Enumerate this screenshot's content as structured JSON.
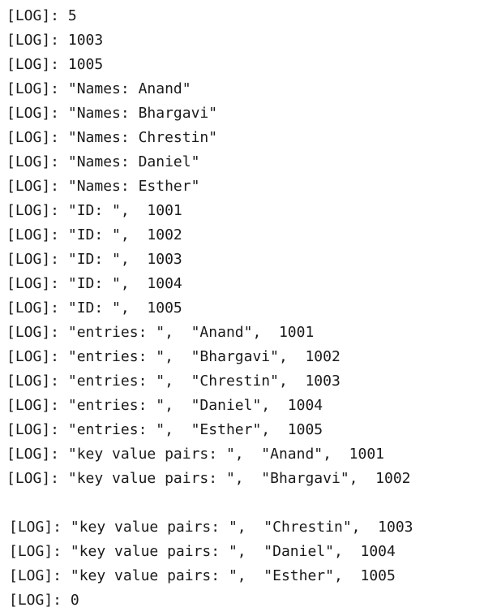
{
  "console": {
    "prefix": "[LOG]:",
    "lines_group_a": [
      {
        "text": "5"
      },
      {
        "text": "1003"
      },
      {
        "text": "1005"
      },
      {
        "text": "\"Names: Anand\""
      },
      {
        "text": "\"Names: Bhargavi\""
      },
      {
        "text": "\"Names: Chrestin\""
      },
      {
        "text": "\"Names: Daniel\""
      },
      {
        "text": "\"Names: Esther\""
      },
      {
        "text": "\"ID: \",  1001"
      },
      {
        "text": "\"ID: \",  1002"
      },
      {
        "text": "\"ID: \",  1003"
      },
      {
        "text": "\"ID: \",  1004"
      },
      {
        "text": "\"ID: \",  1005"
      },
      {
        "text": "\"entries: \",  \"Anand\",  1001"
      },
      {
        "text": "\"entries: \",  \"Bhargavi\",  1002"
      },
      {
        "text": "\"entries: \",  \"Chrestin\",  1003"
      },
      {
        "text": "\"entries: \",  \"Daniel\",  1004"
      },
      {
        "text": "\"entries: \",  \"Esther\",  1005"
      },
      {
        "text": "\"key value pairs: \",  \"Anand\",  1001"
      },
      {
        "text": "\"key value pairs: \",  \"Bhargavi\",  1002"
      }
    ],
    "lines_group_b": [
      {
        "text": "\"key value pairs: \",  \"Chrestin\",  1003"
      },
      {
        "text": "\"key value pairs: \",  \"Daniel\",  1004"
      },
      {
        "text": "\"key value pairs: \",  \"Esther\",  1005"
      },
      {
        "text": "0"
      }
    ]
  }
}
